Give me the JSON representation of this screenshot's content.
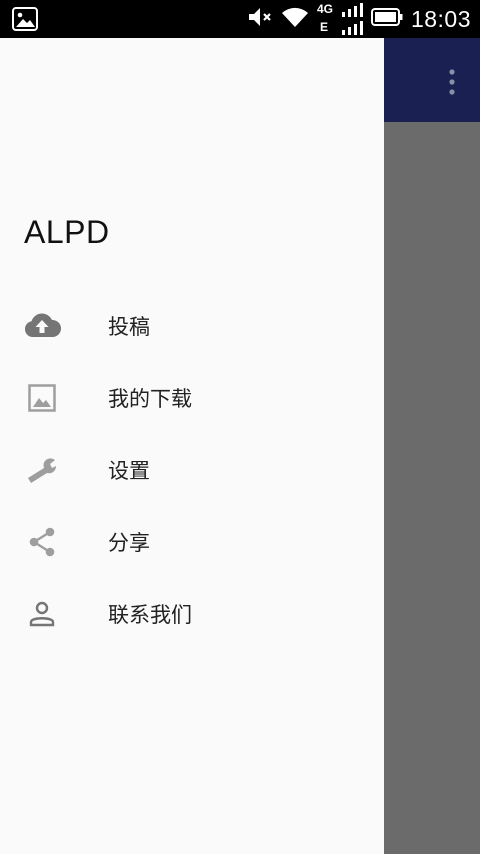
{
  "status_bar": {
    "time": "18:03",
    "network_top": "4G",
    "network_bottom": "E",
    "icons": [
      "image-notification-icon",
      "mute-icon",
      "wifi-icon",
      "signal-icon",
      "battery-icon"
    ]
  },
  "toolbar": {
    "color": "#1a2152",
    "overflow_icon": "overflow-menu-icon"
  },
  "drawer": {
    "title": "ALPD",
    "items": [
      {
        "label": "投稿",
        "icon": "cloud-upload-icon"
      },
      {
        "label": "我的下载",
        "icon": "image-icon"
      },
      {
        "label": "设置",
        "icon": "wrench-icon"
      },
      {
        "label": "分享",
        "icon": "share-icon"
      },
      {
        "label": "联系我们",
        "icon": "person-icon"
      }
    ]
  },
  "colors": {
    "scrim": "#6b6b6b",
    "drawer_bg": "#fafafa",
    "icon": "#757575"
  }
}
